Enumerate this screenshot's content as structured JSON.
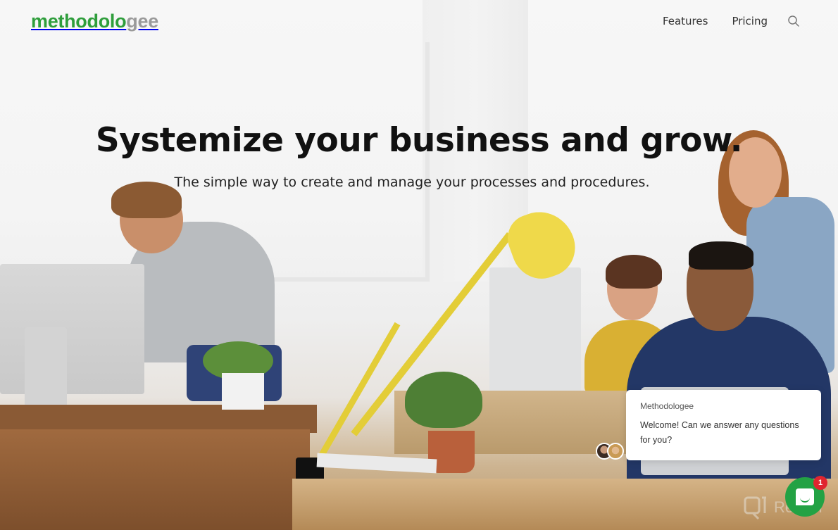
{
  "header": {
    "logo": {
      "part1": "methodo",
      "part2": "lo",
      "part3": "gee",
      "full": "methodologee"
    },
    "nav": [
      {
        "label": "Features"
      },
      {
        "label": "Pricing"
      }
    ],
    "search_icon": "search-icon"
  },
  "hero": {
    "title": "Systemize your business and grow.",
    "subtitle": "The simple way to create and manage your processes and procedures."
  },
  "chat": {
    "sender": "Methodologee",
    "message": "Welcome! Can we answer any questions for you?",
    "badge_count": "1",
    "launcher_icon": "chat-bubble-icon"
  },
  "watermark": {
    "text": "Revain"
  },
  "colors": {
    "brand_green": "#2f9e3c",
    "logo_gray": "#9a9a9a",
    "chat_green": "#23a244",
    "badge_red": "#e0262f"
  }
}
